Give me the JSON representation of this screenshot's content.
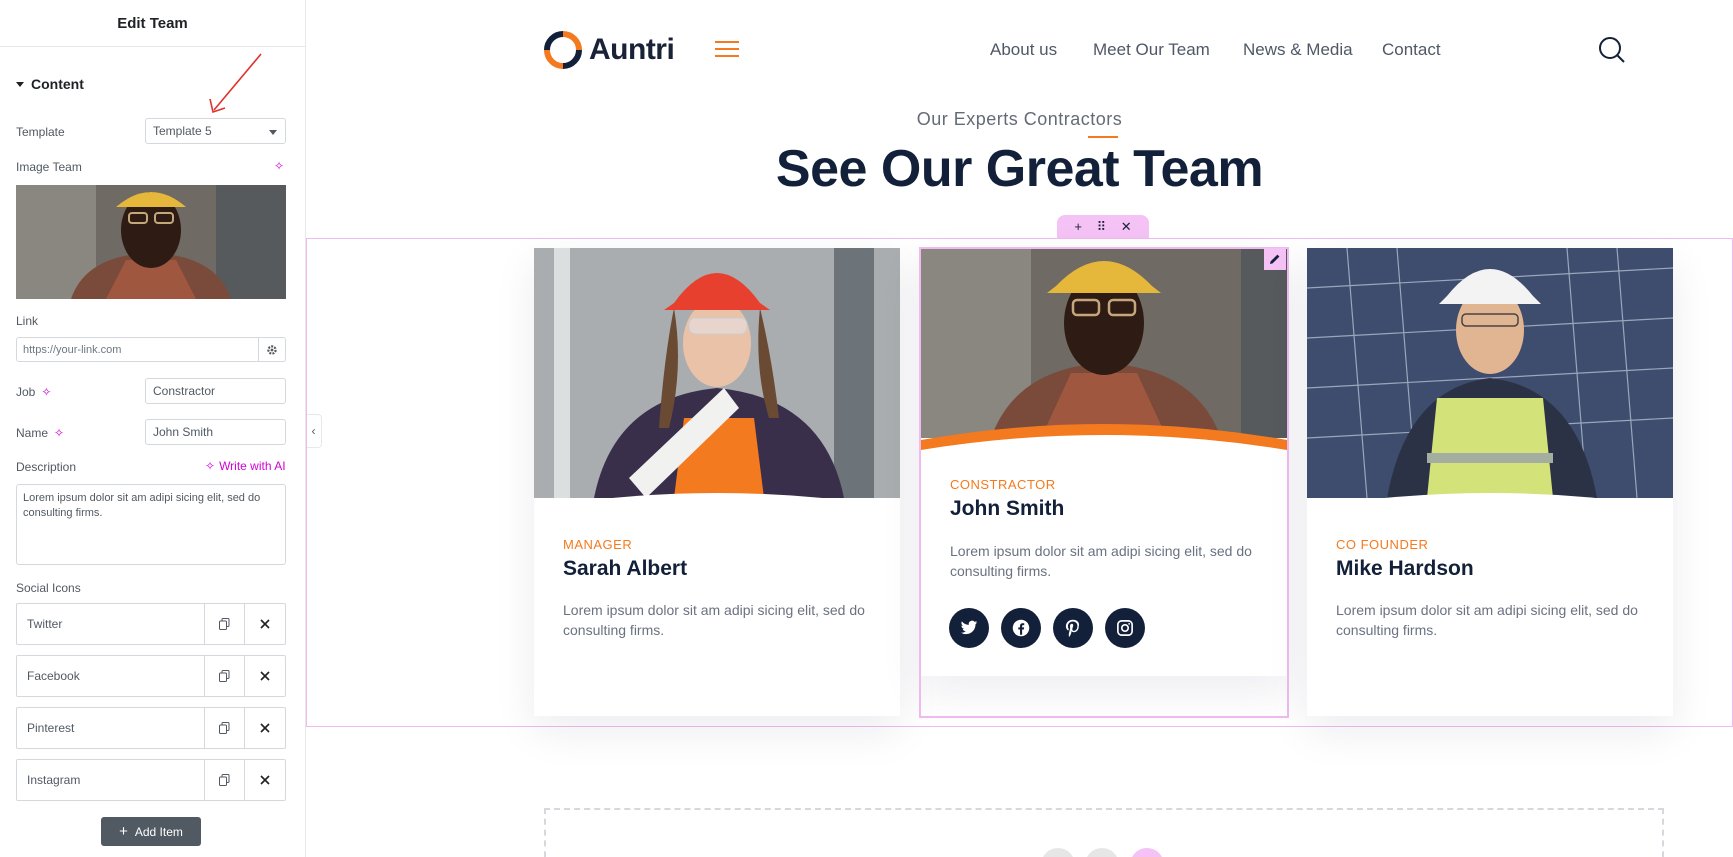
{
  "editor": {
    "title": "Edit Team",
    "section": "Content",
    "template_label": "Template",
    "template_value": "Template 5",
    "image_label": "Image Team",
    "link_label": "Link",
    "link_placeholder": "https://your-link.com",
    "job_label": "Job",
    "job_value": "Constractor",
    "name_label": "Name",
    "name_value": "John Smith",
    "description_label": "Description",
    "write_ai": "Write with AI",
    "description_value": "Lorem ipsum dolor sit am adipi sicing elit, sed do consulting firms.",
    "social_label": "Social Icons",
    "social_items": [
      "Twitter",
      "Facebook",
      "Pinterest",
      "Instagram"
    ],
    "add_item": "Add Item"
  },
  "site": {
    "logo": "Auntri",
    "nav": [
      "About us",
      "Meet Our Team",
      "News & Media",
      "Contact"
    ],
    "subheading": "Our Experts Contractors",
    "heading": "See Our Great Team",
    "accent_color": "#f47a1f",
    "navy_color": "#13203a"
  },
  "team": [
    {
      "job": "MANAGER",
      "name": "Sarah Albert",
      "description": "Lorem ipsum dolor sit am adipi sicing elit, sed do consulting firms."
    },
    {
      "job": "CONSTRACTOR",
      "name": "John Smith",
      "description": "Lorem ipsum dolor sit am adipi sicing elit, sed do consulting firms.",
      "socials": [
        "twitter-icon",
        "facebook-icon",
        "pinterest-icon",
        "instagram-icon"
      ]
    },
    {
      "job": "CO FOUNDER",
      "name": "Mike Hardson",
      "description": "Lorem ipsum dolor sit am adipi sicing elit, sed do consulting firms."
    }
  ]
}
